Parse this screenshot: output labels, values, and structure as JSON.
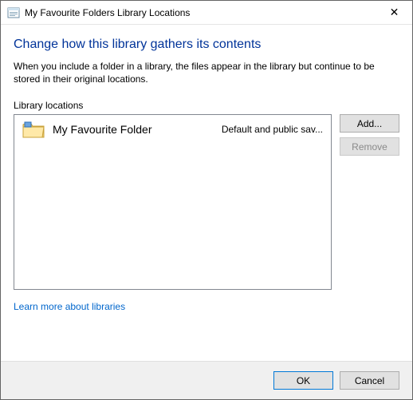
{
  "titlebar": {
    "title": "My Favourite Folders Library Locations",
    "close_glyph": "✕"
  },
  "heading": "Change how this library gathers its contents",
  "description": "When you include a folder in a library, the files appear in the library but continue to be stored in their original locations.",
  "section_label": "Library locations",
  "list": {
    "items": [
      {
        "name": "My Favourite Folder",
        "status": "Default and public sav..."
      }
    ]
  },
  "buttons": {
    "add": "Add...",
    "remove": "Remove",
    "ok": "OK",
    "cancel": "Cancel"
  },
  "link": "Learn more about libraries"
}
